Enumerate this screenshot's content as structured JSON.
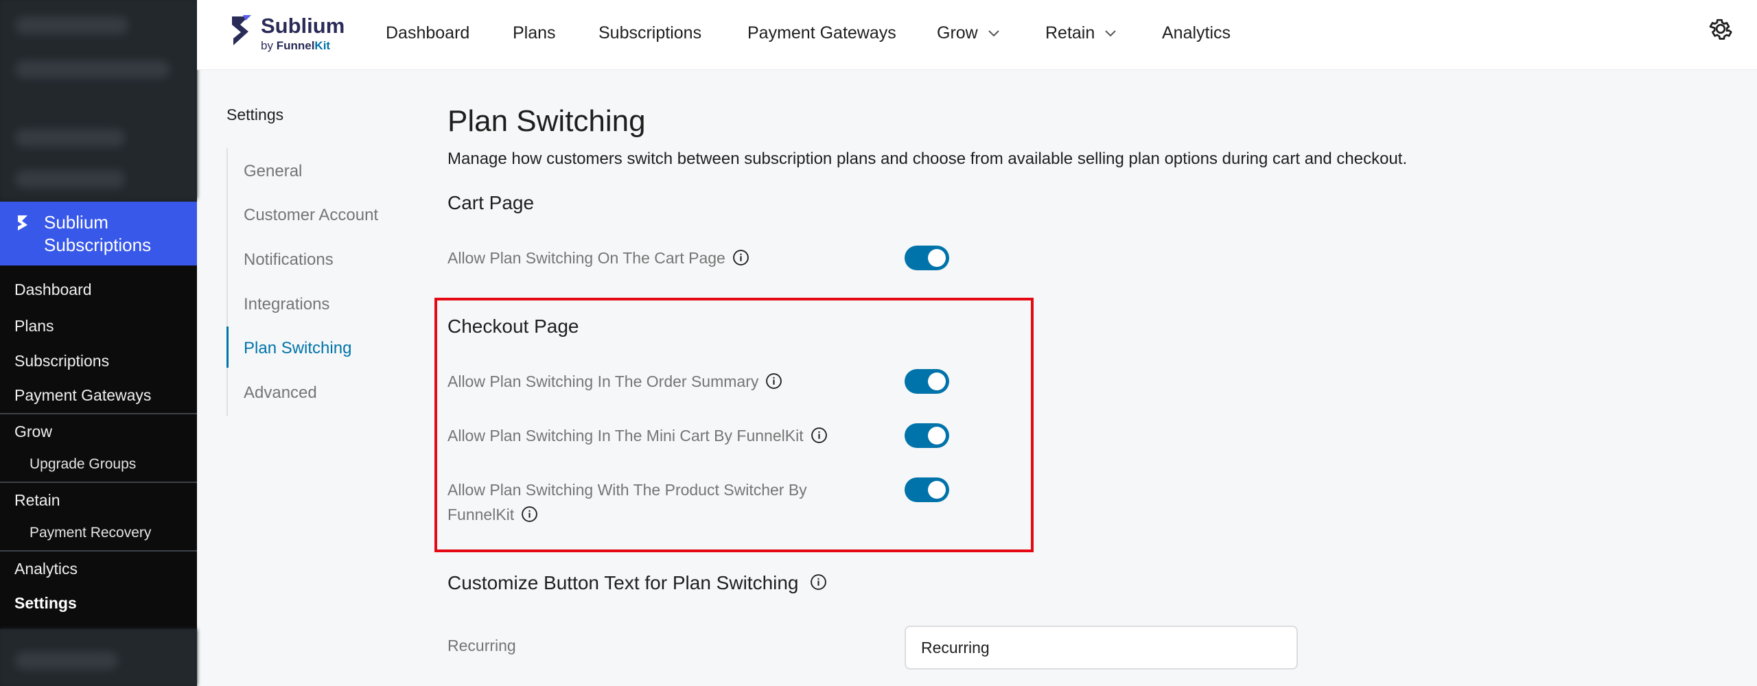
{
  "wp_sidebar": {
    "active_plugin": "Sublium\nSubscriptions",
    "active_plugin_line1": "Sublium",
    "active_plugin_line2": "Subscriptions",
    "menu": [
      {
        "label": "Dashboard"
      },
      {
        "label": "Plans"
      },
      {
        "label": "Subscriptions"
      },
      {
        "label": "Payment Gateways"
      },
      {
        "label": "Grow"
      },
      {
        "label": "Upgrade Groups"
      },
      {
        "label": "Retain"
      },
      {
        "label": "Payment Recovery"
      },
      {
        "label": "Analytics"
      },
      {
        "label": "Settings"
      }
    ]
  },
  "brand": {
    "name": "Sublium",
    "by": "by",
    "funnel": "Funnel",
    "kit": "Kit"
  },
  "topnav": {
    "items": [
      {
        "label": "Dashboard"
      },
      {
        "label": "Plans"
      },
      {
        "label": "Subscriptions"
      },
      {
        "label": "Payment Gateways"
      },
      {
        "label": "Grow"
      },
      {
        "label": "Retain"
      },
      {
        "label": "Analytics"
      }
    ]
  },
  "settings_nav": {
    "title": "Settings",
    "items": [
      {
        "label": "General"
      },
      {
        "label": "Customer Account"
      },
      {
        "label": "Notifications"
      },
      {
        "label": "Integrations"
      },
      {
        "label": "Plan Switching"
      },
      {
        "label": "Advanced"
      }
    ],
    "active": "Plan Switching"
  },
  "main": {
    "title": "Plan Switching",
    "description": "Manage how customers switch between subscription plans and choose from available selling plan options during cart and checkout.",
    "cart_section": {
      "heading": "Cart Page",
      "settings": [
        {
          "label": "Allow Plan Switching On The Cart Page",
          "enabled": true
        }
      ]
    },
    "checkout_section": {
      "heading": "Checkout Page",
      "settings": [
        {
          "label": "Allow Plan Switching In The Order Summary",
          "enabled": true
        },
        {
          "label": "Allow Plan Switching In The Mini Cart By FunnelKit",
          "enabled": true
        },
        {
          "label_line1": "Allow Plan Switching With The Product Switcher By",
          "label_line2": "FunnelKit",
          "enabled": true
        }
      ]
    },
    "button_text_section": {
      "heading": "Customize Button Text for Plan Switching",
      "recurring_label": "Recurring",
      "recurring_value": "Recurring"
    }
  },
  "colors": {
    "accent": "#0073aa",
    "wp_active": "#3858e9",
    "highlight": "#e50914",
    "brand": "#2a2b57"
  }
}
